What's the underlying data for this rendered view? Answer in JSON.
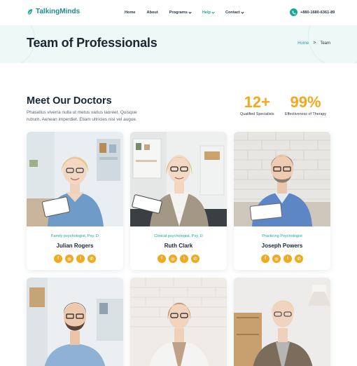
{
  "brand": {
    "name": "TalkingMinds",
    "accent": "#18a89b",
    "highlight": "#f3a91d"
  },
  "nav": {
    "items": [
      {
        "label": "Home",
        "dropdown": false,
        "active": false
      },
      {
        "label": "About",
        "dropdown": false,
        "active": false
      },
      {
        "label": "Programs",
        "dropdown": true,
        "active": false
      },
      {
        "label": "Help",
        "dropdown": true,
        "active": true
      },
      {
        "label": "Contact",
        "dropdown": true,
        "active": false
      }
    ],
    "phone": "+880-1680-6361-89",
    "phone_icon": "phone-icon"
  },
  "hero": {
    "title": "Team of Professionals",
    "breadcrumb": {
      "home": "Home",
      "separator": ">",
      "current": "Team"
    }
  },
  "intro": {
    "title": "Meet Our Doctors",
    "description": "Phasellus viverra nulla ut metus varius laoreet. Quisque rutrum. Aenean imperdiet. Etiam ultricies nisi vel augue.",
    "stats": [
      {
        "value": "12+",
        "label": "Qualified Specialists"
      },
      {
        "value": "99%",
        "label": "Effectiveness of Therapy"
      }
    ]
  },
  "doctors": [
    {
      "role": "Family psychologist, Psy. D",
      "name": "Julian Rogers",
      "photo": "woman-blonde-blue-sweater"
    },
    {
      "role": "Clinical psychologist, Psy. D",
      "name": "Ruth Clark",
      "photo": "woman-blonde-white-blouse-vest"
    },
    {
      "role": "Practicing Psychologist",
      "name": "Joseph Powers",
      "photo": "man-blue-sweater"
    },
    {
      "role": "",
      "name": "",
      "photo": "man-blue-shirt-beard"
    },
    {
      "role": "",
      "name": "",
      "photo": "woman-white-blazer"
    },
    {
      "role": "",
      "name": "",
      "photo": "woman-grey-turtleneck"
    }
  ],
  "social_icons": [
    "facebook-icon",
    "instagram-icon",
    "twitter-icon",
    "whatsapp-icon"
  ],
  "social_glyphs": [
    "f",
    "◎",
    "t",
    "✆"
  ]
}
